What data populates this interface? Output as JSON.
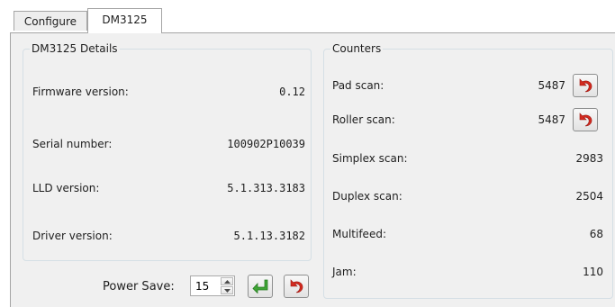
{
  "tabs": [
    {
      "label": "Configure"
    },
    {
      "label": "DM3125"
    }
  ],
  "details": {
    "title": "DM3125 Details",
    "rows": [
      {
        "label": "Firmware version:",
        "value": "0.12"
      },
      {
        "label": "Serial number:",
        "value": "100902P10039"
      },
      {
        "label": "LLD version:",
        "value": "5.1.313.3183"
      },
      {
        "label": "Driver version:",
        "value": "5.1.13.3182"
      }
    ]
  },
  "power_save": {
    "label": "Power Save:",
    "value": "15"
  },
  "counters": {
    "title": "Counters",
    "rows": [
      {
        "label": "Pad scan:",
        "value": "5487"
      },
      {
        "label": "Roller scan:",
        "value": "5487"
      },
      {
        "label": "Simplex scan:",
        "value": "2983"
      },
      {
        "label": "Duplex scan:",
        "value": "2504"
      },
      {
        "label": "Multifeed:",
        "value": "68"
      },
      {
        "label": "Jam:",
        "value": "110"
      }
    ]
  },
  "icons": {
    "apply": "apply-arrow-icon",
    "reset": "reset-arrow-icon",
    "apply_color": "#3fa535",
    "reset_color": "#d42a1f"
  }
}
